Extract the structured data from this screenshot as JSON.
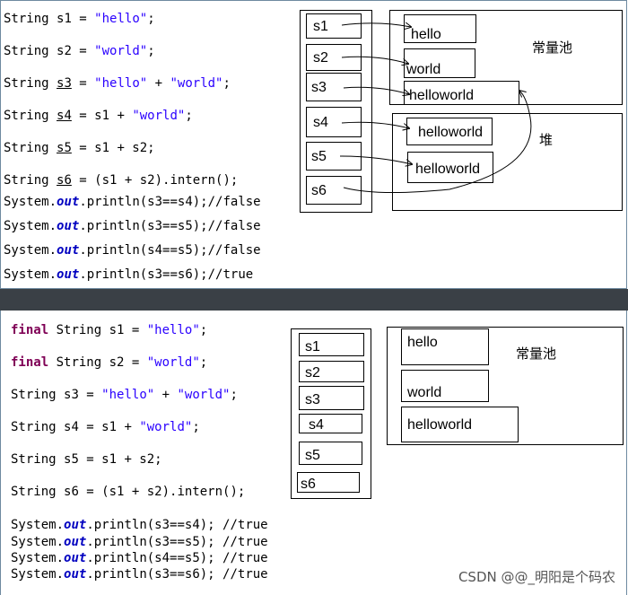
{
  "top": {
    "code": {
      "l1": {
        "a": "String ",
        "b": "s1",
        "c": " = ",
        "d": "\"hello\"",
        "e": ";"
      },
      "l2": {
        "a": "String ",
        "b": "s2",
        "c": " = ",
        "d": "\"world\"",
        "e": ";"
      },
      "l3": {
        "a": "String ",
        "b": "s3",
        "c": " = ",
        "d": "\"hello\"",
        "e": " + ",
        "f": "\"world\"",
        "g": ";"
      },
      "l4": {
        "a": "String ",
        "b": "s4",
        "c": " = s1 + ",
        "d": "\"world\"",
        "e": ";"
      },
      "l5": {
        "a": "String ",
        "b": "s5",
        "c": " = s1 + s2;"
      },
      "l6": {
        "a": "String ",
        "b": "s6",
        "c": " = (s1 + s2).intern();"
      },
      "p1": {
        "a": "System.",
        "b": "out",
        "c": ".println(s3==s4);",
        "d": "//false"
      },
      "p2": {
        "a": "System.",
        "b": "out",
        "c": ".println(s3==s5);",
        "d": "//false"
      },
      "p3": {
        "a": "System.",
        "b": "out",
        "c": ".println(s4==s5);",
        "d": "//false"
      },
      "p4": {
        "a": "System.",
        "b": "out",
        "c": ".println(s3==s6);",
        "d": "//true"
      }
    },
    "stack": [
      "s1",
      "s2",
      "s3",
      "s4",
      "s5",
      "s6"
    ],
    "pool_label": "常量池",
    "pool": [
      "hello",
      "world",
      "helloworld"
    ],
    "heap_label": "堆",
    "heap": [
      "helloworld",
      "helloworld"
    ]
  },
  "bottom": {
    "code": {
      "l1": {
        "k": "final",
        "a": " String ",
        "b": "s1",
        "c": " = ",
        "d": "\"hello\"",
        "e": ";"
      },
      "l2": {
        "k": "final",
        "a": " String ",
        "b": "s2",
        "c": " = ",
        "d": "\"world\"",
        "e": ";"
      },
      "l3": {
        "a": "String ",
        "b": "s3",
        "c": " = ",
        "d": "\"hello\"",
        "e": " + ",
        "f": "\"world\"",
        "g": ";"
      },
      "l4": {
        "a": "String ",
        "b": "s4",
        "c": " = s1 + ",
        "d": "\"world\"",
        "e": ";"
      },
      "l5": {
        "a": "String ",
        "b": "s5",
        "c": " = s1 + s2;"
      },
      "l6": {
        "a": "String ",
        "b": "s6",
        "c": " = (s1 + s2).intern();"
      },
      "p1": {
        "a": "System.",
        "b": "out",
        "c": ".println(s3==s4);",
        "d": " //true"
      },
      "p2": {
        "a": "System.",
        "b": "out",
        "c": ".println(s3==s5);",
        "d": " //true"
      },
      "p3": {
        "a": "System.",
        "b": "out",
        "c": ".println(s4==s5);",
        "d": " //true"
      },
      "p4": {
        "a": "System.",
        "b": "out",
        "c": ".println(s3==s6);",
        "d": " //true"
      }
    },
    "stack": [
      "s1",
      "s2",
      "s3",
      "s4",
      "s5",
      "s6"
    ],
    "pool_label": "常量池",
    "pool": [
      "hello",
      "world",
      "helloworld"
    ]
  },
  "watermark": "CSDN @@_明阳是个码农"
}
